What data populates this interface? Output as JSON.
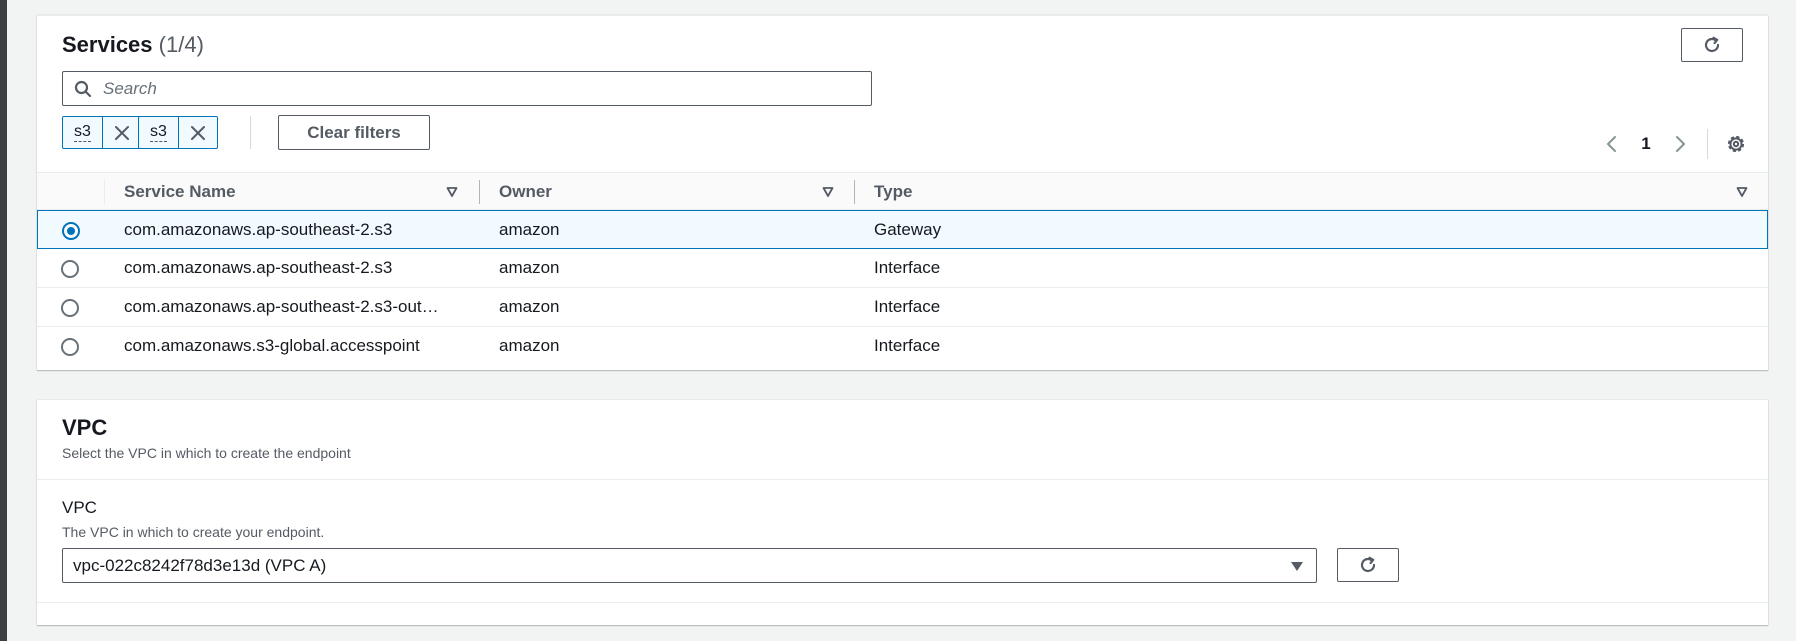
{
  "services": {
    "title": "Services",
    "count": "(1/4)",
    "search_placeholder": "Search",
    "filter_tokens": [
      {
        "label": "s3"
      },
      {
        "label": "s3"
      }
    ],
    "clear_filters_label": "Clear filters",
    "pagination": {
      "current_page": "1"
    },
    "columns": [
      "Service Name",
      "Owner",
      "Type"
    ],
    "rows": [
      {
        "service_name": "com.amazonaws.ap-southeast-2.s3",
        "owner": "amazon",
        "type": "Gateway",
        "selected": true
      },
      {
        "service_name": "com.amazonaws.ap-southeast-2.s3",
        "owner": "amazon",
        "type": "Interface",
        "selected": false
      },
      {
        "service_name": "com.amazonaws.ap-southeast-2.s3-out…",
        "owner": "amazon",
        "type": "Interface",
        "selected": false
      },
      {
        "service_name": "com.amazonaws.s3-global.accesspoint",
        "owner": "amazon",
        "type": "Interface",
        "selected": false
      }
    ]
  },
  "vpc": {
    "heading": "VPC",
    "description": "Select the VPC in which to create the endpoint",
    "field_label": "VPC",
    "field_description": "The VPC in which to create your endpoint.",
    "selected_value": "vpc-022c8242f78d3e13d (VPC A)"
  },
  "colors": {
    "accent": "#0073bb",
    "selected_row_bg": "#f1faff",
    "page_bg": "#f2f3f3"
  }
}
